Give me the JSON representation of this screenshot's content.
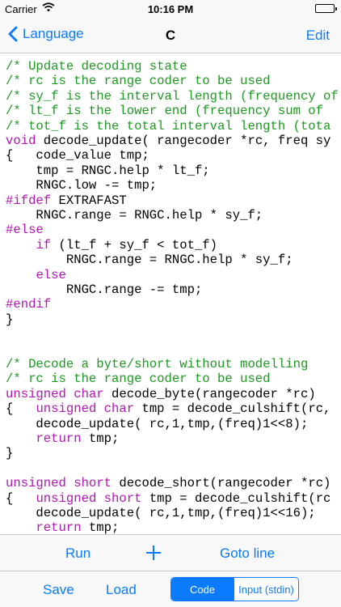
{
  "status_bar": {
    "carrier": "Carrier",
    "time": "10:16 PM"
  },
  "nav": {
    "back_label": "Language",
    "title": "C",
    "edit_label": "Edit"
  },
  "colors": {
    "accent": "#0a7aff",
    "comment": "#1c9a20",
    "keyword": "#b316b4"
  },
  "icons": {
    "back": "chevron-left-icon",
    "add": "plus-icon",
    "wifi": "wifi-icon",
    "battery": "battery-icon"
  },
  "code_lines": [
    [
      {
        "t": "/* Update decoding state",
        "c": "comment"
      }
    ],
    [
      {
        "t": "/* rc is the range coder to be used",
        "c": "comment"
      }
    ],
    [
      {
        "t": "/* sy_f is the interval length (frequency of",
        "c": "comment"
      }
    ],
    [
      {
        "t": "/* lt_f is the lower end (frequency sum of",
        "c": "comment"
      }
    ],
    [
      {
        "t": "/* tot_f is the total interval length (tota",
        "c": "comment"
      }
    ],
    [
      {
        "t": "void",
        "c": "keyword"
      },
      {
        "t": " decode_update( rangecoder *rc, freq sy"
      }
    ],
    [
      {
        "t": "{   code_value tmp;"
      }
    ],
    [
      {
        "t": "    tmp = RNGC.help * lt_f;"
      }
    ],
    [
      {
        "t": "    RNGC.low -= tmp;"
      }
    ],
    [
      {
        "t": "#ifdef",
        "c": "keyword"
      },
      {
        "t": " EXTRAFAST"
      }
    ],
    [
      {
        "t": "    RNGC.range = RNGC.help * sy_f;"
      }
    ],
    [
      {
        "t": "#else",
        "c": "keyword"
      }
    ],
    [
      {
        "t": "    "
      },
      {
        "t": "if",
        "c": "keyword"
      },
      {
        "t": " (lt_f + sy_f < tot_f)"
      }
    ],
    [
      {
        "t": "        RNGC.range = RNGC.help * sy_f;"
      }
    ],
    [
      {
        "t": "    "
      },
      {
        "t": "else",
        "c": "keyword"
      }
    ],
    [
      {
        "t": "        RNGC.range -= tmp;"
      }
    ],
    [
      {
        "t": "#endif",
        "c": "keyword"
      }
    ],
    [
      {
        "t": "}"
      }
    ],
    [],
    [],
    [
      {
        "t": "/* Decode a byte/short without modelling",
        "c": "comment"
      }
    ],
    [
      {
        "t": "/* rc is the range coder to be used",
        "c": "comment"
      }
    ],
    [
      {
        "t": "unsigned",
        "c": "keyword"
      },
      {
        "t": " "
      },
      {
        "t": "char",
        "c": "keyword"
      },
      {
        "t": " decode_byte(rangecoder *rc)"
      }
    ],
    [
      {
        "t": "{   "
      },
      {
        "t": "unsigned",
        "c": "keyword"
      },
      {
        "t": " "
      },
      {
        "t": "char",
        "c": "keyword"
      },
      {
        "t": " tmp = decode_culshift(rc,"
      }
    ],
    [
      {
        "t": "    decode_update( rc,1,tmp,(freq)1<<8);"
      }
    ],
    [
      {
        "t": "    "
      },
      {
        "t": "return",
        "c": "keyword"
      },
      {
        "t": " tmp;"
      }
    ],
    [
      {
        "t": "}"
      }
    ],
    [],
    [
      {
        "t": "unsigned",
        "c": "keyword"
      },
      {
        "t": " "
      },
      {
        "t": "short",
        "c": "keyword"
      },
      {
        "t": " decode_short(rangecoder *rc)"
      }
    ],
    [
      {
        "t": "{   "
      },
      {
        "t": "unsigned",
        "c": "keyword"
      },
      {
        "t": " "
      },
      {
        "t": "short",
        "c": "keyword"
      },
      {
        "t": " tmp = decode_culshift(rc"
      }
    ],
    [
      {
        "t": "    decode_update( rc,1,tmp,(freq)1<<16);"
      }
    ],
    [
      {
        "t": "    "
      },
      {
        "t": "return",
        "c": "keyword"
      },
      {
        "t": " tmp;"
      }
    ]
  ],
  "toolbar": {
    "run_label": "Run",
    "goto_label": "Goto line",
    "save_label": "Save",
    "load_label": "Load",
    "segments": [
      {
        "label": "Code",
        "selected": true
      },
      {
        "label": "Input (stdin)",
        "selected": false
      }
    ]
  }
}
